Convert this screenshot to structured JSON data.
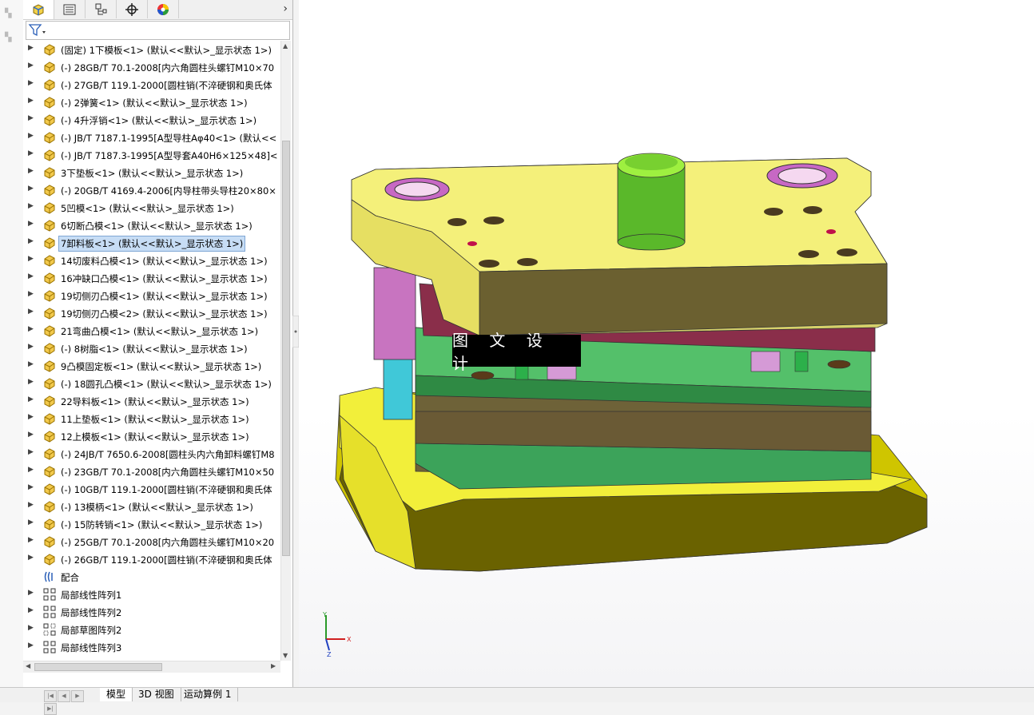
{
  "panel": {
    "tabs": [
      {
        "icon": "feature-manager-icon"
      },
      {
        "icon": "property-manager-icon"
      },
      {
        "icon": "configuration-manager-icon"
      },
      {
        "icon": "dimxpert-icon"
      },
      {
        "icon": "display-manager-icon"
      }
    ],
    "tree": [
      {
        "label": "(固定) 1下模板<1> (默认<<默认>_显示状态 1>)",
        "icon": "part-icon"
      },
      {
        "label": "(-) 28GB/T 70.1-2008[内六角圆柱头螺钉M10×70",
        "icon": "part-icon"
      },
      {
        "label": "(-) 27GB/T 119.1-2000[圆柱销(不淬硬钢和奥氏体",
        "icon": "part-icon"
      },
      {
        "label": "(-) 2弹簧<1> (默认<<默认>_显示状态 1>)",
        "icon": "part-icon"
      },
      {
        "label": "(-) 4升浮销<1> (默认<<默认>_显示状态 1>)",
        "icon": "part-icon"
      },
      {
        "label": "(-) JB/T 7187.1-1995[A型导柱Aφ40<1> (默认<<",
        "icon": "part-icon"
      },
      {
        "label": "(-) JB/T 7187.3-1995[A型导套A40H6×125×48]<",
        "icon": "part-icon"
      },
      {
        "label": "3下垫板<1> (默认<<默认>_显示状态 1>)",
        "icon": "part-icon"
      },
      {
        "label": "(-) 20GB/T 4169.4-2006[内导柱带头导柱20×80×",
        "icon": "part-icon"
      },
      {
        "label": "5凹模<1> (默认<<默认>_显示状态 1>)",
        "icon": "part-icon"
      },
      {
        "label": "6切断凸模<1> (默认<<默认>_显示状态 1>)",
        "icon": "part-icon"
      },
      {
        "label": "7卸料板<1> (默认<<默认>_显示状态 1>)",
        "icon": "part-icon",
        "selected": true
      },
      {
        "label": "14切废料凸模<1> (默认<<默认>_显示状态 1>)",
        "icon": "part-icon"
      },
      {
        "label": "16冲缺口凸模<1> (默认<<默认>_显示状态 1>)",
        "icon": "part-icon"
      },
      {
        "label": "19切侧刃凸模<1> (默认<<默认>_显示状态 1>)",
        "icon": "part-icon"
      },
      {
        "label": "19切侧刃凸模<2> (默认<<默认>_显示状态 1>)",
        "icon": "part-icon"
      },
      {
        "label": "21弯曲凸模<1> (默认<<默认>_显示状态 1>)",
        "icon": "part-icon"
      },
      {
        "label": "(-) 8树脂<1> (默认<<默认>_显示状态 1>)",
        "icon": "part-icon"
      },
      {
        "label": "9凸模固定板<1> (默认<<默认>_显示状态 1>)",
        "icon": "part-icon"
      },
      {
        "label": "(-) 18圆孔凸模<1> (默认<<默认>_显示状态 1>)",
        "icon": "part-icon"
      },
      {
        "label": "22导料板<1> (默认<<默认>_显示状态 1>)",
        "icon": "part-icon"
      },
      {
        "label": "11上垫板<1> (默认<<默认>_显示状态 1>)",
        "icon": "part-icon"
      },
      {
        "label": "12上模板<1> (默认<<默认>_显示状态 1>)",
        "icon": "part-icon"
      },
      {
        "label": "(-) 24JB/T 7650.6-2008[圆柱头内六角卸料螺钉M8",
        "icon": "part-icon"
      },
      {
        "label": "(-) 23GB/T 70.1-2008[内六角圆柱头螺钉M10×50",
        "icon": "part-icon"
      },
      {
        "label": "(-) 10GB/T 119.1-2000[圆柱销(不淬硬钢和奥氏体",
        "icon": "part-icon"
      },
      {
        "label": "(-) 13模柄<1> (默认<<默认>_显示状态 1>)",
        "icon": "part-icon"
      },
      {
        "label": "(-) 15防转销<1> (默认<<默认>_显示状态 1>)",
        "icon": "part-icon"
      },
      {
        "label": "(-) 25GB/T 70.1-2008[内六角圆柱头螺钉M10×20",
        "icon": "part-icon"
      },
      {
        "label": "(-) 26GB/T 119.1-2000[圆柱销(不淬硬钢和奥氏体",
        "icon": "part-icon"
      },
      {
        "label": "配合",
        "icon": "mates-icon",
        "noarrow": true
      },
      {
        "label": "局部线性阵列1",
        "icon": "linear-pattern-icon"
      },
      {
        "label": "局部线性阵列2",
        "icon": "linear-pattern-icon"
      },
      {
        "label": "局部草图阵列2",
        "icon": "sketch-pattern-icon"
      },
      {
        "label": "局部线性阵列3",
        "icon": "linear-pattern-icon"
      }
    ]
  },
  "viewport": {
    "watermark": "图 文 设 计",
    "triad": {
      "x_label": "X",
      "y_label": "Y",
      "z_label": "Z"
    }
  },
  "bottom_tabs": [
    {
      "label": "模型",
      "active": true
    },
    {
      "label": "3D 视图",
      "active": false
    },
    {
      "label": "运动算例 1",
      "active": false
    }
  ],
  "colors": {
    "selection": "#c7ddf5",
    "plate_yellow": "#f0ea78",
    "die_green": "#4db86a",
    "pin_pink": "#d68ad0",
    "post_green": "#6dd42a"
  }
}
